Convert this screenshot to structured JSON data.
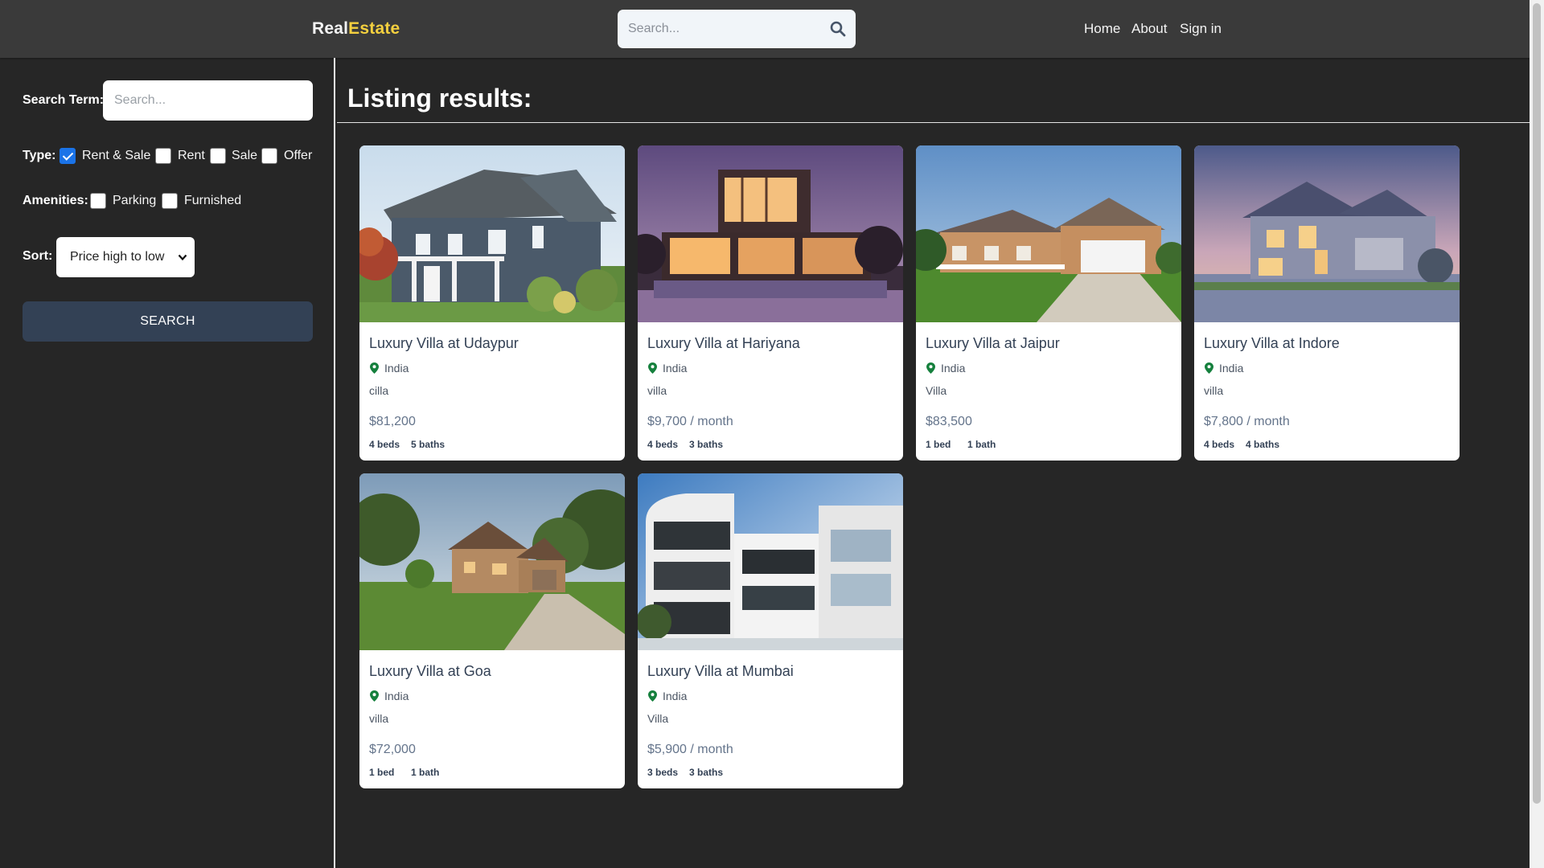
{
  "header": {
    "logo_part1": "Real",
    "logo_part2": "Estate",
    "search_placeholder": "Search...",
    "nav": [
      "Home",
      "About",
      "Sign in"
    ]
  },
  "sidebar": {
    "search_term_label": "Search Term:",
    "search_term_placeholder": "Search...",
    "type_label": "Type:",
    "type_options": [
      {
        "label": "Rent & Sale",
        "checked": true
      },
      {
        "label": "Rent",
        "checked": false
      },
      {
        "label": "Sale",
        "checked": false
      },
      {
        "label": "Offer",
        "checked": false
      }
    ],
    "amenities_label": "Amenities:",
    "amenity_options": [
      {
        "label": "Parking",
        "checked": false
      },
      {
        "label": "Furnished",
        "checked": false
      }
    ],
    "sort_label": "Sort:",
    "sort_value": "Price high to low",
    "search_button": "SEARCH"
  },
  "main": {
    "title": "Listing results:",
    "listings": [
      {
        "title": "Luxury Villa at Udaypur",
        "location": "India",
        "description": "cilla",
        "price": "$81,200",
        "beds": "4 beds",
        "baths": "5 baths"
      },
      {
        "title": "Luxury Villa at Hariyana",
        "location": "India",
        "description": "villa",
        "price": "$9,700 / month",
        "beds": "4 beds",
        "baths": "3 baths"
      },
      {
        "title": "Luxury Villa at Jaipur",
        "location": "India",
        "description": "Villa",
        "price": "$83,500",
        "beds": "1 bed",
        "baths": "1 bath"
      },
      {
        "title": "Luxury Villa at Indore",
        "location": "India",
        "description": "villa",
        "price": "$7,800 / month",
        "beds": "4 beds",
        "baths": "4 baths"
      },
      {
        "title": "Luxury Villa at Goa",
        "location": "India",
        "description": "villa",
        "price": "$72,000",
        "beds": "1 bed",
        "baths": "1 bath"
      },
      {
        "title": "Luxury Villa at Mumbai",
        "location": "India",
        "description": "Villa",
        "price": "$5,900 / month",
        "beds": "3 beds",
        "baths": "3 baths"
      }
    ]
  },
  "colors": {
    "background": "#262626",
    "header": "#3a3a3a",
    "logo_accent": "#f4d03f",
    "button": "#334155",
    "pin": "#15803d"
  }
}
